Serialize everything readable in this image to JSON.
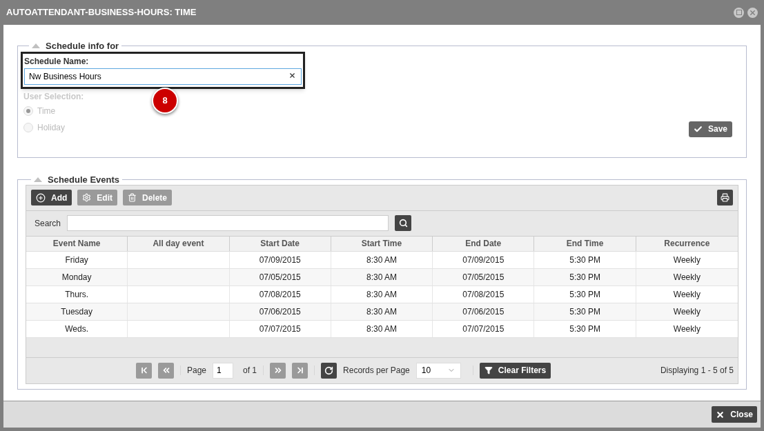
{
  "window": {
    "title": "AUTOATTENDANT-BUSINESS-HOURS: TIME"
  },
  "schedule_info": {
    "title": "Schedule info for",
    "expanded": true,
    "name_label": "Schedule Name:",
    "name_value": "Nw Business Hours",
    "callout": "8",
    "user_selection_label": "User Selection:",
    "options": [
      {
        "label": "Time",
        "selected": true,
        "disabled": true
      },
      {
        "label": "Holiday",
        "selected": false,
        "disabled": true
      }
    ],
    "save_button": "Save"
  },
  "schedule_events": {
    "title": "Schedule Events",
    "expanded": true,
    "toolbar": [
      {
        "kind": "add",
        "label": "Add",
        "disabled": false
      },
      {
        "kind": "edit",
        "label": "Edit",
        "disabled": true
      },
      {
        "kind": "delete",
        "label": "Delete",
        "disabled": true
      }
    ],
    "search_label": "Search",
    "columns": [
      "Event Name",
      "All day event",
      "Start Date",
      "Start Time",
      "End Date",
      "End Time",
      "Recurrence"
    ],
    "rows": [
      [
        "Friday",
        "",
        "07/09/2015",
        "8:30 AM",
        "07/09/2015",
        "5:30 PM",
        "Weekly"
      ],
      [
        "Monday",
        "",
        "07/05/2015",
        "8:30 AM",
        "07/05/2015",
        "5:30 PM",
        "Weekly"
      ],
      [
        "Thurs.",
        "",
        "07/08/2015",
        "8:30 AM",
        "07/08/2015",
        "5:30 PM",
        "Weekly"
      ],
      [
        "Tuesday",
        "",
        "07/06/2015",
        "8:30 AM",
        "07/06/2015",
        "5:30 PM",
        "Weekly"
      ],
      [
        "Weds.",
        "",
        "07/07/2015",
        "8:30 AM",
        "07/07/2015",
        "5:30 PM",
        "Weekly"
      ]
    ],
    "pager": {
      "first_disabled": true,
      "prev_disabled": true,
      "next_disabled": true,
      "last_disabled": true,
      "page_label": "Page",
      "page": "1",
      "of_label": "of 1",
      "records_label": "Records per Page",
      "records_value": "10",
      "clear_filters": "Clear Filters",
      "displaying": "Displaying 1 - 5 of 5"
    }
  },
  "footer": {
    "close_button": "Close"
  }
}
